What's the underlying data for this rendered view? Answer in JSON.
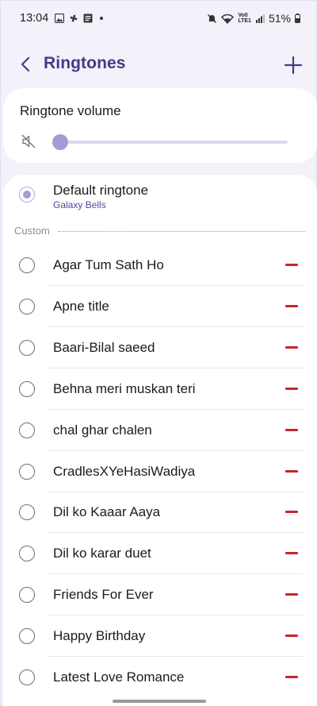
{
  "status_bar": {
    "time": "13:04",
    "network": "Vo0 LTE1",
    "battery": "51%"
  },
  "header": {
    "title": "Ringtones"
  },
  "volume": {
    "label": "Ringtone volume",
    "level": 0
  },
  "default_ringtone": {
    "title": "Default ringtone",
    "subtitle": "Galaxy Bells",
    "selected": true
  },
  "section_label": "Custom",
  "ringtones": [
    {
      "label": "Agar Tum Sath Ho"
    },
    {
      "label": "Apne title"
    },
    {
      "label": "Baari-Bilal saeed"
    },
    {
      "label": "Behna meri muskan teri"
    },
    {
      "label": "chal ghar chalen"
    },
    {
      "label": "CradlesXYeHasiWadiya"
    },
    {
      "label": "Dil ko Kaaar Aaya"
    },
    {
      "label": "Dil ko karar duet"
    },
    {
      "label": "Friends For Ever"
    },
    {
      "label": "Happy Birthday"
    },
    {
      "label": "Latest Love Romance"
    }
  ],
  "colors": {
    "accent": "#3f3d86",
    "slider": "#a99ad6",
    "remove": "#c4262e",
    "background": "#f3f1f9"
  },
  "icons": [
    "back-arrow-icon",
    "add-icon",
    "mute-icon",
    "remove-icon"
  ]
}
